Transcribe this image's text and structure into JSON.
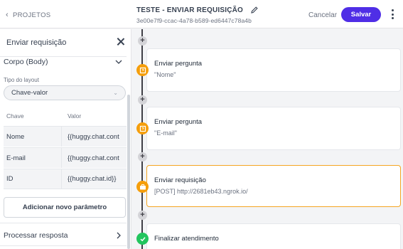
{
  "header": {
    "back_label": "PROJETOS",
    "title": "TESTE - ENVIAR REQUISIÇÃO",
    "flow_id": "3e00e7f9-ccac-4a78-b589-ed6447c78a4b",
    "cancel_label": "Cancelar",
    "save_label": "Salvar",
    "accent_color": "#4f2ee6"
  },
  "panel": {
    "title": "Enviar requisição",
    "body_section_label": "Corpo (Body)",
    "layout_type_label": "Tipo do layout",
    "layout_type_value": "Chave-valor",
    "columns": {
      "key": "Chave",
      "value": "Valor"
    },
    "rows": [
      {
        "key": "Nome",
        "value": "{{huggy.chat.cont"
      },
      {
        "key": "E-mail",
        "value": "{{huggy.chat.cont"
      },
      {
        "key": "ID",
        "value": "{{huggy.chat.id}}"
      }
    ],
    "add_param_label": "Adicionar novo parâmetro",
    "process_response_label": "Processar resposta"
  },
  "flow": {
    "add_symbol": "+",
    "cards": [
      {
        "title": "Enviar pergunta",
        "subtitle": "\"Nome\"",
        "icon": "question-icon",
        "color": "#f59e0b"
      },
      {
        "title": "Enviar pergunta",
        "subtitle": "\"E-mail\"",
        "icon": "question-icon",
        "color": "#f59e0b"
      },
      {
        "title": "Enviar requisição",
        "subtitle": "[POST] http://2681eb43.ngrok.io/",
        "icon": "briefcase-icon",
        "color": "#f59e0b",
        "selected": true
      },
      {
        "title": "Finalizar atendimento",
        "subtitle": "",
        "icon": "check-icon",
        "color": "#22c55e"
      }
    ]
  }
}
